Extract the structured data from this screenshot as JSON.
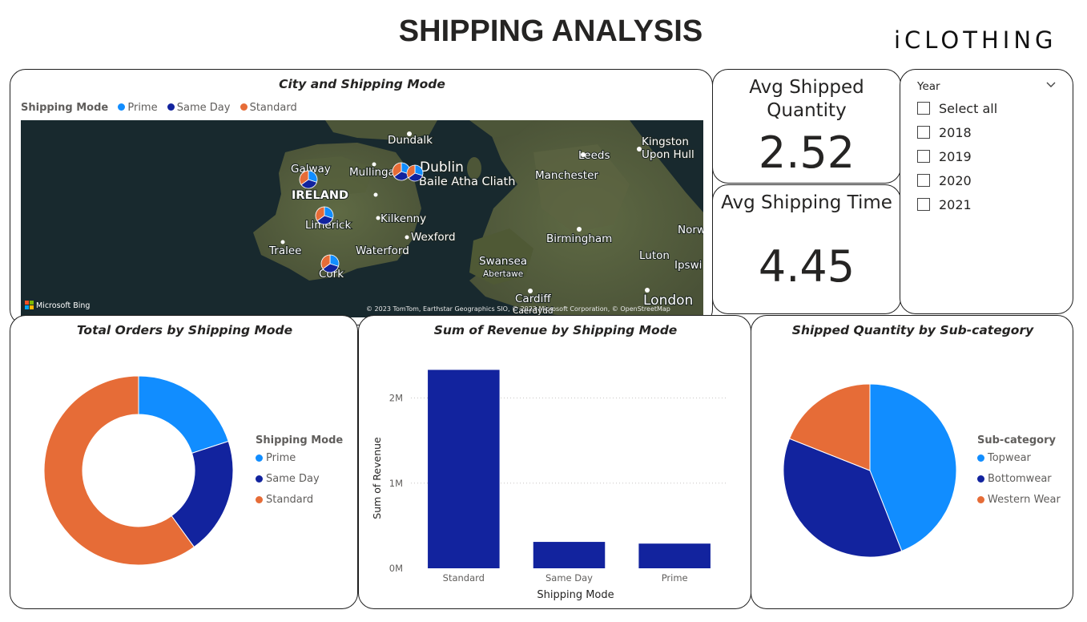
{
  "header": {
    "title": "SHIPPING ANALYSIS",
    "brand": "iCLOTHING"
  },
  "colors": {
    "prime": "#118DFF",
    "same_day": "#12239E",
    "standard": "#E66C37"
  },
  "map": {
    "title": "City and Shipping Mode",
    "legend_title": "Shipping Mode",
    "legend": [
      "Prime",
      "Same Day",
      "Standard"
    ],
    "attribution_logo": "Microsoft Bing",
    "copyright": "© 2023 TomTom, Earthstar Geographics SIO, © 2023 Microsoft Corporation, © OpenStreetMap",
    "labels": {
      "dundalk": "Dundalk",
      "dublin": "Dublin",
      "baile": "Baile Atha Cliath",
      "galway": "Galway",
      "mullingar": "Mullingar",
      "ireland": "IRELAND",
      "limerick": "Limerick",
      "kilkenny": "Kilkenny",
      "wexford": "Wexford",
      "waterford": "Waterford",
      "tralee": "Tralee",
      "cork": "Cork",
      "kingston": "Kingston",
      "upon_hull": "Upon Hull",
      "leeds": "Leeds",
      "manchester": "Manchester",
      "birmingham": "Birmingham",
      "norw": "Norw",
      "luton": "Luton",
      "ipswi": "Ipswi",
      "swansea": "Swansea",
      "abertawe": "Abertawe",
      "cardiff": "Cardiff",
      "caerdydd": "Caerdydd",
      "london": "London"
    }
  },
  "kpis": {
    "avg_shipped_quantity": {
      "label_line1": "Avg Shipped",
      "label_line2": "Quantity",
      "value": "2.52"
    },
    "avg_shipping_time": {
      "label": "Avg Shipping Time",
      "value": "4.45"
    }
  },
  "slicer": {
    "title": "Year",
    "items": [
      {
        "label": "Select all",
        "checked": false
      },
      {
        "label": "2018",
        "checked": false
      },
      {
        "label": "2019",
        "checked": false
      },
      {
        "label": "2020",
        "checked": false
      },
      {
        "label": "2021",
        "checked": false
      }
    ]
  },
  "chart_data": [
    {
      "type": "pie",
      "variant": "donut",
      "title": "Total Orders by Shipping Mode",
      "legend_title": "Shipping Mode",
      "legend_position": "right",
      "categories": [
        "Prime",
        "Same Day",
        "Standard"
      ],
      "values": [
        20,
        20,
        60
      ],
      "colors": [
        "#118DFF",
        "#12239E",
        "#E66C37"
      ]
    },
    {
      "type": "bar",
      "title": "Sum of Revenue by Shipping Mode",
      "xlabel": "Shipping Mode",
      "ylabel": "Sum of Revenue",
      "categories": [
        "Standard",
        "Same Day",
        "Prime"
      ],
      "values": [
        2330000,
        310000,
        290000
      ],
      "ylim": [
        0,
        2400000
      ],
      "yticks": [
        "0M",
        "1M",
        "2M"
      ],
      "ytick_values": [
        0,
        1000000,
        2000000
      ],
      "grid": true,
      "color": "#12239E"
    },
    {
      "type": "pie",
      "title": "Shipped Quantity by Sub-category",
      "legend_title": "Sub-category",
      "legend_position": "right",
      "categories": [
        "Topwear",
        "Bottomwear",
        "Western Wear"
      ],
      "values": [
        44,
        37,
        19
      ],
      "colors": [
        "#118DFF",
        "#12239E",
        "#E66C37"
      ]
    }
  ]
}
